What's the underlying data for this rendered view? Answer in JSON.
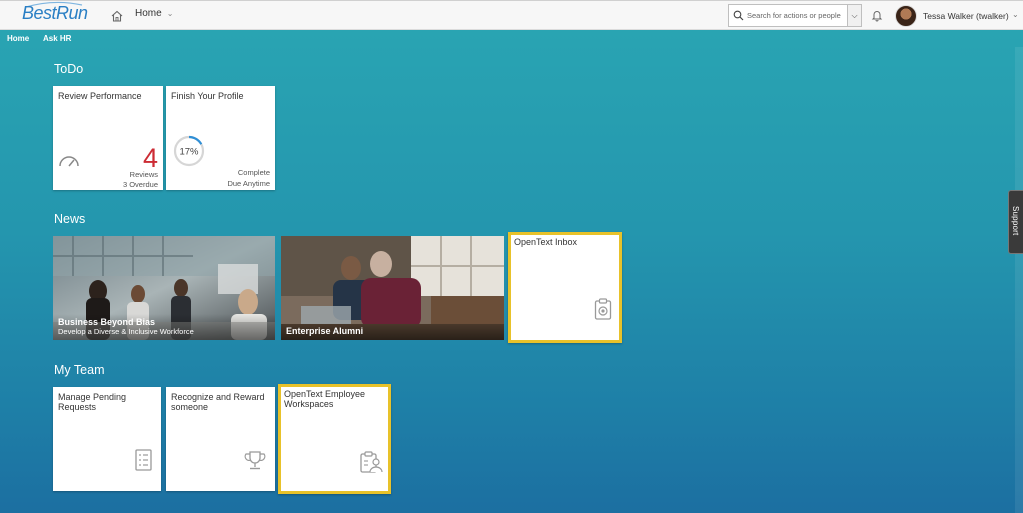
{
  "header": {
    "logo_text": "BestRun",
    "home_menu_label": "Home",
    "search_placeholder": "Search for actions or people",
    "user_name": "Tessa Walker (twalker)"
  },
  "subnav": {
    "items": [
      "Home",
      "Ask HR"
    ]
  },
  "sections": {
    "todo": {
      "title": "ToDo",
      "tiles": [
        {
          "title": "Review Performance",
          "number": "4",
          "line1": "Reviews",
          "line2": "3 Overdue",
          "icon": "speedometer-icon"
        },
        {
          "title": "Finish Your Profile",
          "progress_label": "17%",
          "progress": 0.17,
          "line1": "Complete",
          "line2": "Due Anytime"
        }
      ]
    },
    "news": {
      "title": "News",
      "tiles": [
        {
          "title": "Business Beyond Bias",
          "subtitle": "Develop a Diverse & Inclusive Workforce"
        },
        {
          "title": "Enterprise Alumni"
        },
        {
          "title": "OpenText Inbox",
          "icon": "inbox-clipboard-icon"
        }
      ]
    },
    "team": {
      "title": "My Team",
      "tiles": [
        {
          "title": "Manage Pending Requests",
          "icon": "checklist-icon"
        },
        {
          "title": "Recognize and Reward someone",
          "icon": "trophy-icon"
        },
        {
          "title": "OpenText Employee Workspaces",
          "icon": "employee-clipboard-icon"
        }
      ]
    }
  },
  "support_label": "Support",
  "colors": {
    "highlight_border": "#e8c22a",
    "number_red": "#cc2b34",
    "brand_blue": "#2a7fc4"
  }
}
